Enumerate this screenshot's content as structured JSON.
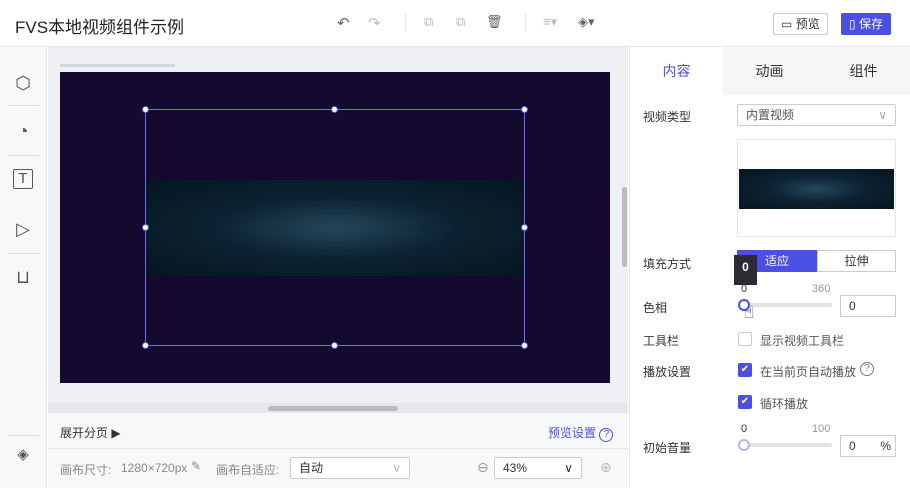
{
  "header": {
    "title": "FVS本地视频组件示例",
    "preview": "预览",
    "save": "保存"
  },
  "footer": {
    "expand_pages": "展开分页",
    "preview_settings": "预览设置",
    "canvas_size_label": "画布尺寸:",
    "canvas_size": "1280×720px",
    "adapt_label": "画布自适应:",
    "adapt_value": "自动",
    "zoom": "43%"
  },
  "panel": {
    "tabs": [
      "内容",
      "动画",
      "组件"
    ],
    "video_type_label": "视频类型",
    "video_type": "内置视频",
    "fill_label": "填充方式",
    "fill_options": [
      "适应",
      "拉伸"
    ],
    "hue_label": "色相",
    "hue_min": "0",
    "hue_max": "360",
    "hue_value": "0",
    "hue_tooltip": "0",
    "toolbar_label": "工具栏",
    "toolbar_option": "显示视频工具栏",
    "play_label": "播放设置",
    "autoplay": "在当前页自动播放",
    "loop": "循环播放",
    "volume_label": "初始音量",
    "vol_min": "0",
    "vol_max": "100",
    "vol_value": "0",
    "vol_unit": "%"
  }
}
